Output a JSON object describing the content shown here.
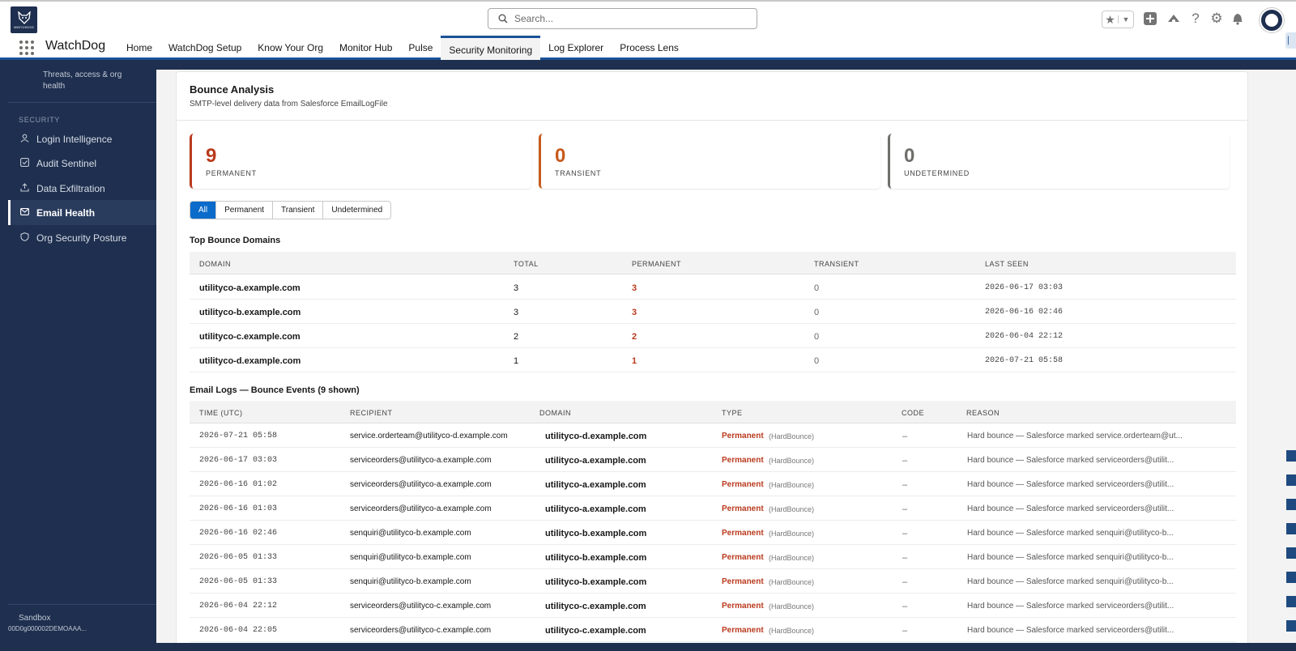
{
  "global": {
    "logo_text": "WATCHDOG",
    "search_placeholder": "Search..."
  },
  "appnav": {
    "app_name": "WatchDog",
    "tabs": [
      {
        "label": "Home",
        "active": false
      },
      {
        "label": "WatchDog Setup",
        "active": false
      },
      {
        "label": "Know Your Org",
        "active": false
      },
      {
        "label": "Monitor Hub",
        "active": false
      },
      {
        "label": "Pulse",
        "active": false
      },
      {
        "label": "Security Monitoring",
        "active": true
      },
      {
        "label": "Log Explorer",
        "active": false
      },
      {
        "label": "Process Lens",
        "active": false
      }
    ]
  },
  "sidebar": {
    "description": "Threats, access & org health",
    "section_label": "SECURITY",
    "items": [
      {
        "label": "Login Intelligence",
        "icon": "user-icon",
        "active": false
      },
      {
        "label": "Audit Sentinel",
        "icon": "checkbox-icon",
        "active": false
      },
      {
        "label": "Data Exfiltration",
        "icon": "upload-icon",
        "active": false
      },
      {
        "label": "Email Health",
        "icon": "mail-icon",
        "active": true
      },
      {
        "label": "Org Security Posture",
        "icon": "shield-icon",
        "active": false
      }
    ],
    "env_label": "Sandbox",
    "org_id": "00D0g000002DEMOAAA..."
  },
  "bounce": {
    "title": "Bounce Analysis",
    "subtitle": "SMTP-level delivery data from Salesforce EmailLogFile",
    "stats": [
      {
        "value": "9",
        "label": "PERMANENT",
        "color": "#ba3a1e"
      },
      {
        "value": "0",
        "label": "TRANSIENT",
        "color": "#c75a1c"
      },
      {
        "value": "0",
        "label": "UNDETERMINED",
        "color": "#706e6b"
      }
    ],
    "filters": [
      "All",
      "Permanent",
      "Transient",
      "Undetermined"
    ],
    "active_filter": "All"
  },
  "domains": {
    "title": "Top Bounce Domains",
    "columns": [
      "DOMAIN",
      "TOTAL",
      "PERMANENT",
      "TRANSIENT",
      "LAST SEEN"
    ],
    "rows": [
      {
        "domain": "utilityco-a.example.com",
        "total": "3",
        "permanent": "3",
        "transient": "0",
        "last_seen": "2026-06-17 03:03"
      },
      {
        "domain": "utilityco-b.example.com",
        "total": "3",
        "permanent": "3",
        "transient": "0",
        "last_seen": "2026-06-16 02:46"
      },
      {
        "domain": "utilityco-c.example.com",
        "total": "2",
        "permanent": "2",
        "transient": "0",
        "last_seen": "2026-06-04 22:12"
      },
      {
        "domain": "utilityco-d.example.com",
        "total": "1",
        "permanent": "1",
        "transient": "0",
        "last_seen": "2026-07-21 05:58"
      }
    ]
  },
  "logs": {
    "title": "Email Logs — Bounce Events (9 shown)",
    "columns": [
      "TIME (UTC)",
      "RECIPIENT",
      "DOMAIN",
      "TYPE",
      "CODE",
      "REASON"
    ],
    "rows": [
      {
        "time": "2026-07-21 05:58",
        "recipient": "service.orderteam@utilityco-d.example.com",
        "domain": "utilityco-d.example.com",
        "type": "Permanent",
        "subtype": "(HardBounce)",
        "code": "–",
        "reason": "Hard bounce — Salesforce marked service.orderteam@ut..."
      },
      {
        "time": "2026-06-17 03:03",
        "recipient": "serviceorders@utilityco-a.example.com",
        "domain": "utilityco-a.example.com",
        "type": "Permanent",
        "subtype": "(HardBounce)",
        "code": "–",
        "reason": "Hard bounce — Salesforce marked serviceorders@utilit..."
      },
      {
        "time": "2026-06-16 01:02",
        "recipient": "serviceorders@utilityco-a.example.com",
        "domain": "utilityco-a.example.com",
        "type": "Permanent",
        "subtype": "(HardBounce)",
        "code": "–",
        "reason": "Hard bounce — Salesforce marked serviceorders@utilit..."
      },
      {
        "time": "2026-06-16 01:03",
        "recipient": "serviceorders@utilityco-a.example.com",
        "domain": "utilityco-a.example.com",
        "type": "Permanent",
        "subtype": "(HardBounce)",
        "code": "–",
        "reason": "Hard bounce — Salesforce marked serviceorders@utilit..."
      },
      {
        "time": "2026-06-16 02:46",
        "recipient": "senquiri@utilityco-b.example.com",
        "domain": "utilityco-b.example.com",
        "type": "Permanent",
        "subtype": "(HardBounce)",
        "code": "–",
        "reason": "Hard bounce — Salesforce marked senquiri@utilityco-b..."
      },
      {
        "time": "2026-06-05 01:33",
        "recipient": "senquiri@utilityco-b.example.com",
        "domain": "utilityco-b.example.com",
        "type": "Permanent",
        "subtype": "(HardBounce)",
        "code": "–",
        "reason": "Hard bounce — Salesforce marked senquiri@utilityco-b..."
      },
      {
        "time": "2026-06-05 01:33",
        "recipient": "senquiri@utilityco-b.example.com",
        "domain": "utilityco-b.example.com",
        "type": "Permanent",
        "subtype": "(HardBounce)",
        "code": "–",
        "reason": "Hard bounce — Salesforce marked senquiri@utilityco-b..."
      },
      {
        "time": "2026-06-04 22:12",
        "recipient": "serviceorders@utilityco-c.example.com",
        "domain": "utilityco-c.example.com",
        "type": "Permanent",
        "subtype": "(HardBounce)",
        "code": "–",
        "reason": "Hard bounce — Salesforce marked serviceorders@utilit..."
      },
      {
        "time": "2026-06-04 22:05",
        "recipient": "serviceorders@utilityco-c.example.com",
        "domain": "utilityco-c.example.com",
        "type": "Permanent",
        "subtype": "(HardBounce)",
        "code": "–",
        "reason": "Hard bounce — Salesforce marked serviceorders@utilit..."
      }
    ]
  }
}
